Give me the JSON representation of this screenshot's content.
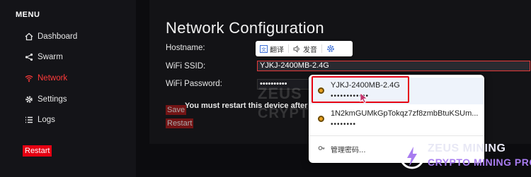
{
  "sidebar": {
    "menu_title": "MENU",
    "items": [
      {
        "label": "Dashboard",
        "icon": "home-icon"
      },
      {
        "label": "Swarm",
        "icon": "share-icon"
      },
      {
        "label": "Network",
        "icon": "wifi-icon",
        "active": true
      },
      {
        "label": "Settings",
        "icon": "gear-icon"
      },
      {
        "label": "Logs",
        "icon": "list-icon"
      }
    ],
    "restart_label": "Restart"
  },
  "main": {
    "title": "Network Configuration",
    "hostname_label": "Hostname:",
    "ssid_label": "WiFi SSID:",
    "ssid_value": "YJKJ-2400MB-2.4G",
    "password_label": "WiFi Password:",
    "password_value": "••••••••••",
    "save_label": "Save",
    "restart_label": "Restart",
    "warning": "You must restart this device after sav"
  },
  "watermark": {
    "line1": "ZEUS",
    "line2": "CRYPTO"
  },
  "translate_toolbar": {
    "translate_label": "翻译",
    "pronounce_label": "发音",
    "settings_icon": "gear-icon"
  },
  "autofill": {
    "entries": [
      {
        "ssid": "YJKJ-2400MB-2.4G",
        "password": "••••••••••••",
        "selected": true
      },
      {
        "ssid": "1N2kmGUMkGpTokqz7zf8zmbBtuKSUm...",
        "password": "••••••••"
      }
    ],
    "manage_label": "管理密码..."
  },
  "brand": {
    "line1": "ZEUS MINING",
    "line2": "CRYPTO MINING PRO",
    "accent": "#a87cf0",
    "highlight": "#e60012"
  }
}
